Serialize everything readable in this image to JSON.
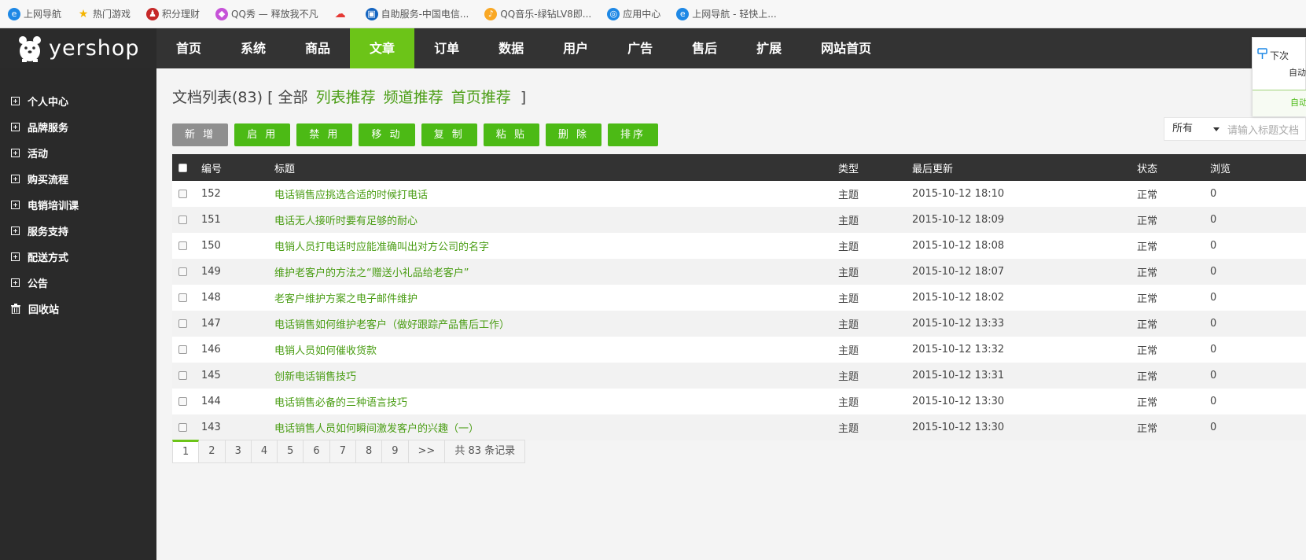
{
  "bookmarks": [
    {
      "label": "上网导航",
      "icon": "ie-icon",
      "color": "#1e88e5"
    },
    {
      "label": "热门游戏",
      "icon": "star-icon",
      "color": "#f4b400"
    },
    {
      "label": "积分理财",
      "icon": "penguin-icon",
      "color": "#c62828"
    },
    {
      "label": "QQ秀 — 释放我不凡",
      "icon": "qqshow-icon",
      "color": "#c653d8"
    },
    {
      "label": "",
      "icon": "cloud-icon",
      "color": "#e53935"
    },
    {
      "label": "自助服务-中国电信...",
      "icon": "telecom-icon",
      "color": "#1565c0"
    },
    {
      "label": "QQ音乐-绿钻LV8即...",
      "icon": "qqmusic-icon",
      "color": "#f9a825"
    },
    {
      "label": "应用中心",
      "icon": "appcenter-icon",
      "color": "#1e88e5"
    },
    {
      "label": "上网导航 - 轻快上...",
      "icon": "ie-icon",
      "color": "#1e88e5"
    }
  ],
  "logo": {
    "text": "yershop"
  },
  "nav": {
    "items": [
      "首页",
      "系统",
      "商品",
      "文章",
      "订单",
      "数据",
      "用户",
      "广告",
      "售后",
      "扩展",
      "网站首页"
    ],
    "active_index": 3,
    "active_color": "#6cc418"
  },
  "sidebar": {
    "items": [
      "个人中心",
      "品牌服务",
      "活动",
      "购买流程",
      "电销培训课",
      "服务支持",
      "配送方式",
      "公告",
      "回收站"
    ]
  },
  "heading": {
    "title": "文档列表(83)",
    "bracket_open": "[",
    "filters": [
      "全部",
      "列表推荐",
      "频道推荐",
      "首页推荐"
    ],
    "bracket_close": "]"
  },
  "toolbar": {
    "buttons": [
      "新 增",
      "启 用",
      "禁 用",
      "移 动",
      "复 制",
      "粘 贴",
      "删 除",
      "排序"
    ]
  },
  "search": {
    "select_value": "所有",
    "placeholder": "请输入标题文档"
  },
  "table": {
    "headers": {
      "id": "编号",
      "title": "标题",
      "type": "类型",
      "updated": "最后更新",
      "status": "状态",
      "views": "浏览"
    },
    "rows": [
      {
        "id": "152",
        "title": "电话销售应挑选合适的时候打电话",
        "type": "主题",
        "updated": "2015-10-12 18:10",
        "status": "正常",
        "views": "0"
      },
      {
        "id": "151",
        "title": "电话无人接听时要有足够的耐心",
        "type": "主题",
        "updated": "2015-10-12 18:09",
        "status": "正常",
        "views": "0"
      },
      {
        "id": "150",
        "title": "电销人员打电话时应能准确叫出对方公司的名字",
        "type": "主题",
        "updated": "2015-10-12 18:08",
        "status": "正常",
        "views": "0"
      },
      {
        "id": "149",
        "title": "维护老客户的方法之“赠送小礼品给老客户”",
        "type": "主题",
        "updated": "2015-10-12 18:07",
        "status": "正常",
        "views": "0"
      },
      {
        "id": "148",
        "title": "老客户维护方案之电子邮件维护",
        "type": "主题",
        "updated": "2015-10-12 18:02",
        "status": "正常",
        "views": "0"
      },
      {
        "id": "147",
        "title": "电话销售如何维护老客户（做好跟踪产品售后工作）",
        "type": "主题",
        "updated": "2015-10-12 13:33",
        "status": "正常",
        "views": "0"
      },
      {
        "id": "146",
        "title": "电销人员如何催收货款",
        "type": "主题",
        "updated": "2015-10-12 13:32",
        "status": "正常",
        "views": "0"
      },
      {
        "id": "145",
        "title": "创新电话销售技巧",
        "type": "主题",
        "updated": "2015-10-12 13:31",
        "status": "正常",
        "views": "0"
      },
      {
        "id": "144",
        "title": "电话销售必备的三种语言技巧",
        "type": "主题",
        "updated": "2015-10-12 13:30",
        "status": "正常",
        "views": "0"
      },
      {
        "id": "143",
        "title": "电话销售人员如何瞬间激发客户的兴趣（一）",
        "type": "主题",
        "updated": "2015-10-12 13:30",
        "status": "正常",
        "views": "0"
      }
    ]
  },
  "pagination": {
    "pages": [
      "1",
      "2",
      "3",
      "4",
      "5",
      "6",
      "7",
      "8",
      "9"
    ],
    "current": "1",
    "next": ">>",
    "summary": "共 83 条记录"
  },
  "popup": {
    "line1": "下次",
    "line2": "自动",
    "line3": "自动"
  }
}
